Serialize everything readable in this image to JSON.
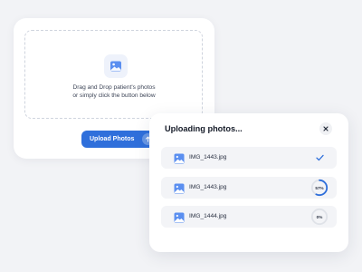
{
  "upload_card": {
    "drop_text_line1": "Drag and Drop patient's photos",
    "drop_text_line2": "or simply click the button below",
    "upload_button_label": "Upload Photos",
    "image_icon": "image-icon",
    "upload_icon": "arrow-up-icon"
  },
  "progress_panel": {
    "title": "Uploading photos...",
    "close_icon": "close-icon",
    "files": [
      {
        "name": "IMG_1443.jpg",
        "status": "complete",
        "progress": 1.0,
        "label": ""
      },
      {
        "name": "IMG_1443.jpg",
        "status": "uploading",
        "progress": 0.57,
        "label": "57%"
      },
      {
        "name": "IMG_1444.jpg",
        "status": "pending",
        "progress": 0.0,
        "label": "0%"
      }
    ]
  },
  "colors": {
    "accent": "#2f6fdb",
    "background": "#f2f3f6",
    "card": "#ffffff",
    "row": "#f3f4f7",
    "ring_track": "#dfe2e8"
  }
}
